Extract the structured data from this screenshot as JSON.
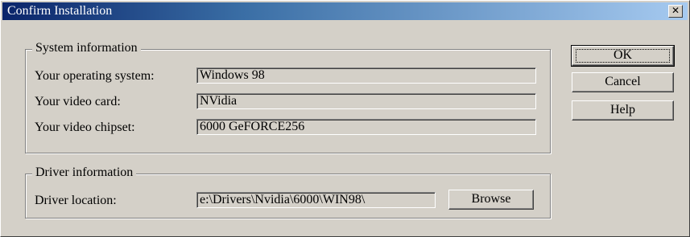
{
  "window": {
    "title": "Confirm Installation"
  },
  "system_group": {
    "legend": "System information",
    "rows": [
      {
        "label": "Your operating system:",
        "value": "Windows 98"
      },
      {
        "label": "Your video card:",
        "value": "NVidia"
      },
      {
        "label": "Your video chipset:",
        "value": "6000 GeFORCE256"
      }
    ]
  },
  "driver_group": {
    "legend": "Driver information",
    "location_label": "Driver location:",
    "location_value": "e:\\Drivers\\Nvidia\\6000\\WIN98\\",
    "browse_label": "Browse"
  },
  "buttons": {
    "ok": "OK",
    "cancel": "Cancel",
    "help": "Help"
  },
  "icons": {
    "close": "close-icon"
  }
}
